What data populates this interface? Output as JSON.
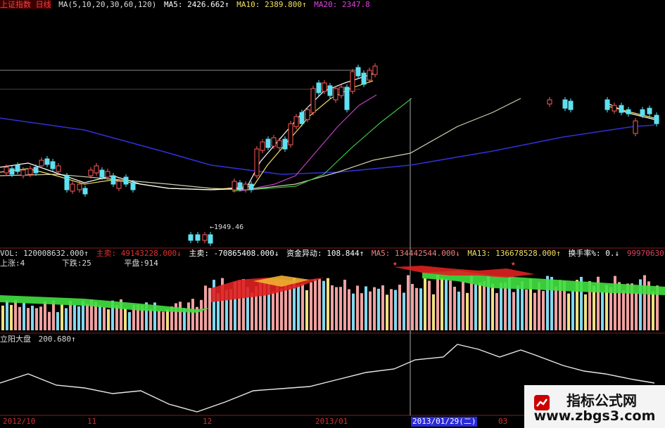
{
  "header": {
    "name": "上证指数 日线",
    "ma_params": "MA(5,10,20,30,60,120)",
    "ma5": "MA5: 2426.662↑",
    "ma10": "MA10: 2389.800↑",
    "ma20": "MA20: 2347.8",
    "low_label": "←1949.46"
  },
  "vol_header": {
    "vol": "VOL: 120008632.000↑",
    "main_sell_label": "主卖: 49143228.000↓",
    "main_buy_label": "主卖: -70865408.000↓",
    "fund_label": "资金异动: 108.844↑",
    "ma5": "MA5: 134442544.000↓",
    "ma13": "MA13: 136678528.000↑",
    "turnover": "换手率%: 0.↓",
    "tail": "99970630",
    "up": "上涨:4",
    "down": "下跌:25",
    "flat": "平盘:914"
  },
  "indicator": {
    "name": "立阳大盘",
    "value": "200.680↑"
  },
  "dates": [
    "2012/10",
    "11",
    "12",
    "2013/01",
    "2013/01/29(二)",
    "03"
  ],
  "watermark": {
    "line1": "指标公式网",
    "line2": "www.zbgs3.com"
  },
  "colors": {
    "up": "#ff5a5a",
    "down": "#5fe0f0",
    "ma_slow": "#3030d8",
    "ma20": "#c040c0",
    "ma30": "#40c040",
    "ma60": "#d0d0b0",
    "vol_pink": "#f0a0a0",
    "vol_yellow": "#f0e080",
    "vol_cyan": "#80d8f0",
    "band_green": "#40e040",
    "band_red": "#e02020",
    "indicator_line": "#e8e8e8"
  },
  "chart_data": [
    {
      "type": "line",
      "title": "上证指数 日线",
      "series": [
        {
          "name": "MA5",
          "values": [
            2426.662
          ]
        },
        {
          "name": "MA10",
          "values": [
            2389.8
          ]
        }
      ],
      "annotations": [
        "←1949.46"
      ]
    },
    {
      "type": "bar",
      "title": "VOL",
      "series": [
        {
          "name": "VOL",
          "values": [
            120008632
          ]
        }
      ]
    },
    {
      "type": "line",
      "title": "立阳大盘",
      "series": [
        {
          "name": "立阳大盘",
          "values": [
            200.68
          ]
        }
      ]
    }
  ]
}
